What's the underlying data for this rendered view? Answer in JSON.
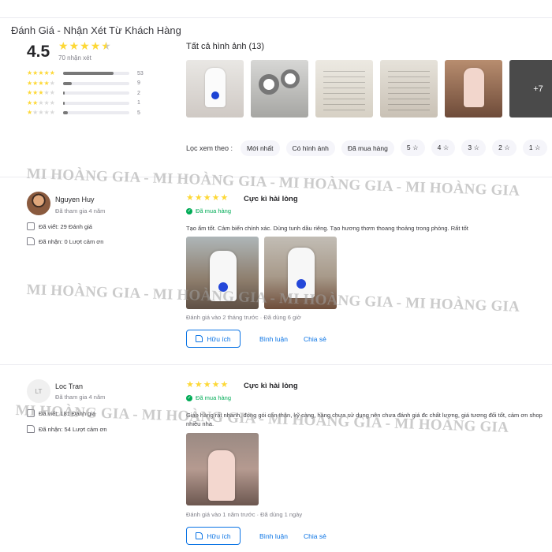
{
  "header": {
    "title": "Đánh Giá - Nhận Xét Từ Khách Hàng"
  },
  "summary": {
    "score": "4.5",
    "count_label": "70 nhận xét",
    "distribution": [
      {
        "stars": 5,
        "count": "53",
        "fraction": 0.757
      },
      {
        "stars": 4,
        "count": "9",
        "fraction": 0.129
      },
      {
        "stars": 3,
        "count": "2",
        "fraction": 0.029
      },
      {
        "stars": 2,
        "count": "1",
        "fraction": 0.014
      },
      {
        "stars": 1,
        "count": "5",
        "fraction": 0.071
      }
    ]
  },
  "gallery": {
    "label": "Tất cả hình ảnh (13)",
    "more_label": "+7"
  },
  "filters": {
    "label": "Lọc xem theo :",
    "chips": [
      "Mới nhất",
      "Có hình ảnh",
      "Đã mua hàng",
      "5",
      "4",
      "3",
      "2",
      "1"
    ]
  },
  "watermark": "MI HOÀNG GIA - MI HOÀNG GIA - MI HOÀNG GIA - MI HOÀNG GIA",
  "reviews": [
    {
      "name": "Nguyen Huy",
      "joined": "Đã tham gia 4 năm",
      "written": "Đã viết: 29 Đánh giá",
      "received": "Đã nhận: 0 Lượt cảm ơn",
      "title": "Cực kì hài lòng",
      "verified": "Đã mua hàng",
      "text": "Tạo ẩm tốt. Cảm biến chính xác. Dùng tunh dầu riêng. Tạo hương thơm thoang thoảng trong phòng. Rất tốt",
      "meta": "Đánh giá vào 2 tháng trước  ·  Đã dùng 6 giờ",
      "helpful": "Hữu ích",
      "comment": "Bình luận",
      "share": "Chia sẻ"
    },
    {
      "initials": "LT",
      "name": "Loc Tran",
      "joined": "Đã tham gia 4 năm",
      "written": "Đã viết: 181 Đánh giá",
      "received": "Đã nhận: 54 Lượt cảm ơn",
      "title": "Cực kì hài lòng",
      "verified": "Đã mua hàng",
      "text": "Giao hàng rất nhanh, đóng gói cẩn thận, kỹ càng, hàng chưa sử dụng nên chưa đánh giá đc chất lượng, giá tương đối tốt, cảm ơn shop nhiều nha.",
      "meta": "Đánh giá vào 1 năm trước  ·  Đã dùng 1 ngày",
      "helpful": "Hữu ích",
      "comment": "Bình luận",
      "share": "Chia sẻ"
    }
  ],
  "colors": {
    "star": "#fdd836",
    "accent": "#0b74e5",
    "verified": "#00ab56"
  }
}
